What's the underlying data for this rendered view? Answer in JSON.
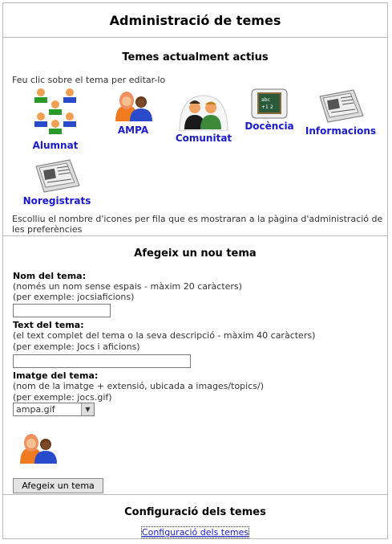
{
  "page": {
    "title": "Administració de temes"
  },
  "active": {
    "title": "Temes actualment actius",
    "instruction": "Feu clic sobre el tema per editar-lo",
    "topics": [
      {
        "label": "Alumnat",
        "icon": "students-icon"
      },
      {
        "label": "AMPA",
        "icon": "parents-icon"
      },
      {
        "label": "Comunitat",
        "icon": "community-icon"
      },
      {
        "label": "Docència",
        "icon": "blackboard-icon"
      },
      {
        "label": "Informacions",
        "icon": "newspaper-icon"
      },
      {
        "label": "Noregistrats",
        "icon": "newspaper-icon"
      }
    ],
    "footer_line1": "Escolliu el nombre d'icones per fila que es mostraran a la pàgina d'administració de",
    "footer_line2": "les preferències"
  },
  "add": {
    "title": "Afegeix un nou tema",
    "name_label": "Nom del tema:",
    "name_hint": "(només un nom sense espais - màxim 20 caràcters)",
    "name_example": "(per exemple: jocsiaficions)",
    "name_value": "",
    "text_label": "Text del tema:",
    "text_hint": "(el text complet del tema o la seva descripció - màxim 40 caràcters)",
    "text_example": "(per exemple: Jocs i aficions)",
    "text_value": "",
    "image_label": "Imatge del tema:",
    "image_hint": "(nom de la imatge + extensió, ubicada a images/topics/)",
    "image_example": "(per exemple: jocs.gif)",
    "image_selected": "ampa.gif",
    "preview_icon": "parents-icon",
    "submit_label": "Afegeix un tema"
  },
  "config": {
    "title": "Configuració dels temes",
    "link_label": "Configuració dels temes"
  }
}
